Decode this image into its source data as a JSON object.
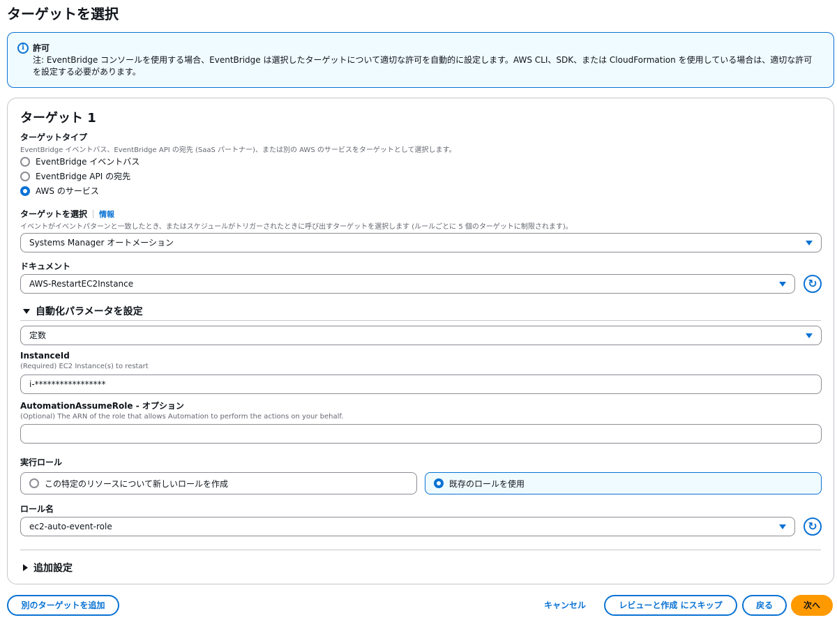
{
  "page": {
    "title": "ターゲットを選択"
  },
  "alert": {
    "icon": "info-icon",
    "title": "許可",
    "body": "注: EventBridge コンソールを使用する場合、EventBridge は選択したターゲットについて適切な許可を自動的に設定します。AWS CLI、SDK、または CloudFormation を使用している場合は、適切な許可を設定する必要があります。"
  },
  "target": {
    "heading": "ターゲット 1",
    "type": {
      "label": "ターゲットタイプ",
      "description": "EventBridge イベントバス、EventBridge API の宛先 (SaaS パートナー)、または別の AWS のサービスをターゲットとして選択します。",
      "options": [
        {
          "label": "EventBridge イベントバス",
          "selected": false
        },
        {
          "label": "EventBridge API の宛先",
          "selected": false
        },
        {
          "label": "AWS のサービス",
          "selected": true
        }
      ]
    },
    "select_target": {
      "label": "ターゲットを選択",
      "info_link": "情報",
      "description": "イベントがイベントパターンと一致したとき、またはスケジュールがトリガーされたときに呼び出すターゲットを選択します (ルールごとに 5 個のターゲットに制限されます)。",
      "value": "Systems Manager オートメーション"
    },
    "document": {
      "label": "ドキュメント",
      "value": "AWS-RestartEC2Instance"
    },
    "automation_params": {
      "label": "自動化パラメータを設定",
      "mode_value": "定数",
      "instance_id": {
        "label": "InstanceId",
        "description": "(Required) EC2 Instance(s) to restart",
        "value": "i-*****************"
      },
      "assume_role": {
        "label": "AutomationAssumeRole - オプション",
        "description": "(Optional) The ARN of the role that allows Automation to perform the actions on your behalf.",
        "value": ""
      }
    },
    "execution_role": {
      "label": "実行ロール",
      "options": [
        {
          "label": "この特定のリソースについて新しいロールを作成",
          "selected": false
        },
        {
          "label": "既存のロールを使用",
          "selected": true
        }
      ]
    },
    "role_name": {
      "label": "ロール名",
      "value": "ec2-auto-event-role"
    },
    "additional_settings": {
      "label": "追加設定"
    }
  },
  "footer": {
    "add_target": "別のターゲットを追加",
    "cancel": "キャンセル",
    "skip_review": "レビューと作成 にスキップ",
    "back": "戻る",
    "next": "次へ"
  },
  "colors": {
    "accent": "#0972d3",
    "primary_button": "#ff9900",
    "alert_bg": "#f0fbff"
  }
}
